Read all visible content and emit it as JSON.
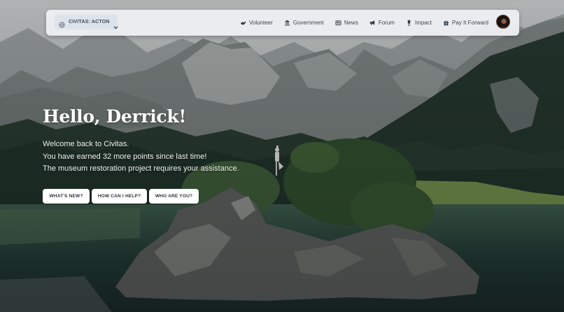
{
  "navbar": {
    "brand": {
      "label": "CIVITAS: ACTON",
      "icon": "globe-icon"
    },
    "items": [
      {
        "label": "Volunteer",
        "icon": "volunteer-icon"
      },
      {
        "label": "Government",
        "icon": "government-icon"
      },
      {
        "label": "News",
        "icon": "news-icon"
      },
      {
        "label": "Forum",
        "icon": "forum-icon"
      },
      {
        "label": "Impact",
        "icon": "impact-icon"
      },
      {
        "label": "Pay It Forward",
        "icon": "gift-icon"
      }
    ],
    "avatar": "user-avatar"
  },
  "hero": {
    "title": "Hello, Derrick!",
    "lines": [
      "Welcome back to Civitas.",
      "You have earned 32 more points since last time!",
      "The museum restoration project requires your assistance."
    ],
    "buttons": [
      {
        "label": "WHAT'S NEW?"
      },
      {
        "label": "HOW CAN I HELP?"
      },
      {
        "label": "WHO ARE YOU?"
      }
    ]
  },
  "colors": {
    "navbar_bg": "#eef0f3",
    "nav_text": "#3a4656",
    "button_bg": "#ffffff",
    "button_text": "#2b3440",
    "hero_text": "#ffffff"
  }
}
